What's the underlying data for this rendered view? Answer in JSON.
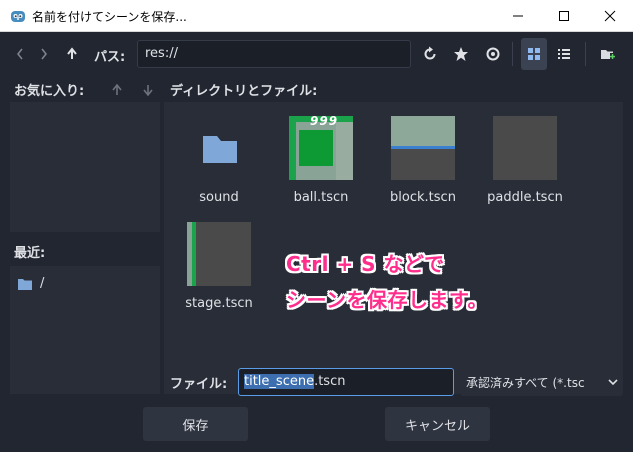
{
  "window": {
    "title": "名前を付けてシーンを保存...",
    "minimize_icon": "minimize-icon",
    "maximize_icon": "maximize-icon",
    "close_icon": "close-icon"
  },
  "toolbar": {
    "path_label": "パス:",
    "path_value": "res://",
    "back_icon": "chevron-left-icon",
    "forward_icon": "chevron-right-icon",
    "up_icon": "arrow-up-icon",
    "refresh_icon": "refresh-icon",
    "favorite_icon": "star-icon",
    "hidden_toggle_icon": "eye-icon",
    "grid_view_icon": "grid-icon",
    "list_view_icon": "list-icon",
    "new_folder_icon": "new-folder-icon"
  },
  "sidebar": {
    "favorites_label": "お気に入り:",
    "recent_label": "最近:",
    "recent_items": [
      {
        "label": "/",
        "icon": "folder-icon"
      }
    ]
  },
  "main": {
    "files_label": "ディレクトリとファイル:",
    "files": [
      {
        "name": "sound",
        "kind": "folder"
      },
      {
        "name": "ball.tscn",
        "kind": "scene"
      },
      {
        "name": "block.tscn",
        "kind": "scene"
      },
      {
        "name": "paddle.tscn",
        "kind": "scene"
      },
      {
        "name": "stage.tscn",
        "kind": "scene"
      }
    ],
    "ball_thumb_text": "999"
  },
  "annotation": {
    "line1": "Ctrl + S などで",
    "line2": "シーンを保存します。",
    "color": "#ff2d8b"
  },
  "footer": {
    "file_label": "ファイル:",
    "filename_selected": "title_scene",
    "filename_rest": ".tscn",
    "filter_value": "承認済みすべて (*.tsc",
    "save_label": "保存",
    "cancel_label": "キャンセル"
  },
  "colors": {
    "background": "#212631",
    "panel": "#282d38",
    "accent": "#5a9ce8",
    "folder": "#7fa8d8"
  }
}
